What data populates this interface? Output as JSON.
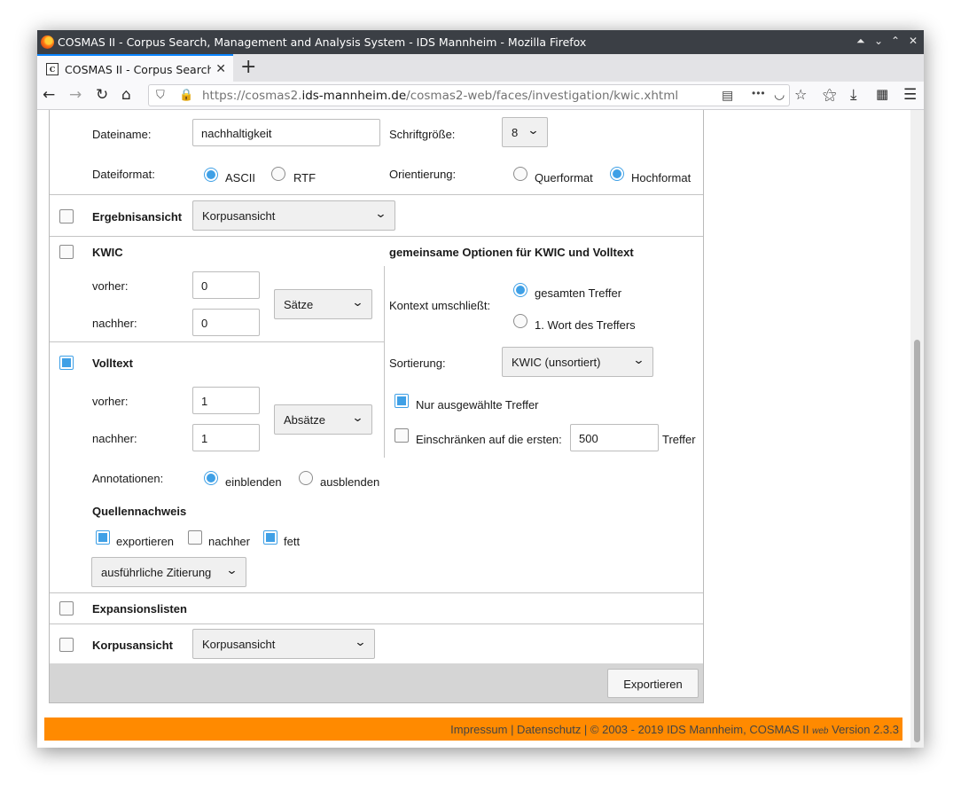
{
  "window": {
    "title": "COSMAS II - Corpus Search, Management and Analysis System - IDS Mannheim - Mozilla Firefox",
    "controls": [
      "⌃",
      "⌄",
      "⌃",
      "✕"
    ]
  },
  "tabs": [
    {
      "title": "COSMAS II - Corpus Search, Management and Analysis System",
      "favicon": "C"
    }
  ],
  "nav": {
    "url_prefix": "https://cosmas2.",
    "url_domain": "ids-mannheim.de",
    "url_path": "/cosmas2-web/faces/investigation/kwic.xhtml",
    "more": "•••"
  },
  "form": {
    "dateiname_label": "Dateiname:",
    "dateiname_value": "nachhaltigkeit",
    "schriftgroesse_label": "Schriftgröße:",
    "schriftgroesse_value": "8",
    "dateiformat_label": "Dateiformat:",
    "format_ascii": "ASCII",
    "format_rtf": "RTF",
    "orientierung_label": "Orientierung:",
    "orient_quer": "Querformat",
    "orient_hoch": "Hochformat",
    "ergebnisansicht_label": "Ergebnisansicht",
    "ergebnisansicht_value": "Korpusansicht",
    "kwic_label": "KWIC",
    "gemeinsame_label": "gemeinsame Optionen für KWIC und Volltext",
    "kwic_vorher_label": "vorher:",
    "kwic_vorher_value": "0",
    "kwic_nachher_label": "nachher:",
    "kwic_nachher_value": "0",
    "kwic_unit": "Sätze",
    "kontext_label": "Kontext umschließt:",
    "kontext_gesamt": "gesamten Treffer",
    "kontext_wort": "1. Wort des Treffers",
    "volltext_label": "Volltext",
    "sortierung_label": "Sortierung:",
    "sortierung_value": "KWIC (unsortiert)",
    "vt_vorher_label": "vorher:",
    "vt_vorher_value": "1",
    "vt_nachher_label": "nachher:",
    "vt_nachher_value": "1",
    "vt_unit": "Absätze",
    "nur_ausgewaehlte": "Nur ausgewählte Treffer",
    "einschraenken": "Einschränken auf die ersten:",
    "einschraenken_value": "500",
    "treffer": "Treffer",
    "annotationen_label": "Annotationen:",
    "einblenden": "einblenden",
    "ausblenden": "ausblenden",
    "quellennachweis_label": "Quellennachweis",
    "exportieren_opt": "exportieren",
    "nachher_opt": "nachher",
    "fett_opt": "fett",
    "zitierung_value": "ausführliche Zitierung",
    "expansionslisten_label": "Expansionslisten",
    "korpusansicht_label": "Korpusansicht",
    "korpusansicht_value": "Korpusansicht",
    "export_button": "Exportieren"
  },
  "footer": {
    "text": "Impressum | Datenschutz | © 2003 - 2019 IDS Mannheim, COSMAS II",
    "web": "web",
    "version": "Version 2.3.3"
  },
  "colors": {
    "accent": "#3fa0e6",
    "footer_bg": "#ff8a00",
    "titlebar": "#3b3f45"
  }
}
